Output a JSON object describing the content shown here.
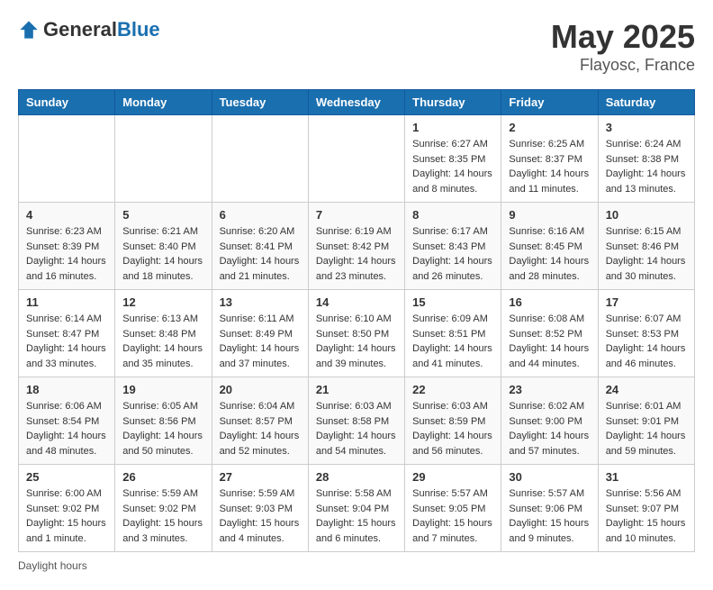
{
  "header": {
    "logo_general": "General",
    "logo_blue": "Blue",
    "month": "May 2025",
    "location": "Flayosc, France"
  },
  "weekdays": [
    "Sunday",
    "Monday",
    "Tuesday",
    "Wednesday",
    "Thursday",
    "Friday",
    "Saturday"
  ],
  "weeks": [
    [
      {
        "day": "",
        "info": ""
      },
      {
        "day": "",
        "info": ""
      },
      {
        "day": "",
        "info": ""
      },
      {
        "day": "",
        "info": ""
      },
      {
        "day": "1",
        "info": "Sunrise: 6:27 AM\nSunset: 8:35 PM\nDaylight: 14 hours and 8 minutes."
      },
      {
        "day": "2",
        "info": "Sunrise: 6:25 AM\nSunset: 8:37 PM\nDaylight: 14 hours and 11 minutes."
      },
      {
        "day": "3",
        "info": "Sunrise: 6:24 AM\nSunset: 8:38 PM\nDaylight: 14 hours and 13 minutes."
      }
    ],
    [
      {
        "day": "4",
        "info": "Sunrise: 6:23 AM\nSunset: 8:39 PM\nDaylight: 14 hours and 16 minutes."
      },
      {
        "day": "5",
        "info": "Sunrise: 6:21 AM\nSunset: 8:40 PM\nDaylight: 14 hours and 18 minutes."
      },
      {
        "day": "6",
        "info": "Sunrise: 6:20 AM\nSunset: 8:41 PM\nDaylight: 14 hours and 21 minutes."
      },
      {
        "day": "7",
        "info": "Sunrise: 6:19 AM\nSunset: 8:42 PM\nDaylight: 14 hours and 23 minutes."
      },
      {
        "day": "8",
        "info": "Sunrise: 6:17 AM\nSunset: 8:43 PM\nDaylight: 14 hours and 26 minutes."
      },
      {
        "day": "9",
        "info": "Sunrise: 6:16 AM\nSunset: 8:45 PM\nDaylight: 14 hours and 28 minutes."
      },
      {
        "day": "10",
        "info": "Sunrise: 6:15 AM\nSunset: 8:46 PM\nDaylight: 14 hours and 30 minutes."
      }
    ],
    [
      {
        "day": "11",
        "info": "Sunrise: 6:14 AM\nSunset: 8:47 PM\nDaylight: 14 hours and 33 minutes."
      },
      {
        "day": "12",
        "info": "Sunrise: 6:13 AM\nSunset: 8:48 PM\nDaylight: 14 hours and 35 minutes."
      },
      {
        "day": "13",
        "info": "Sunrise: 6:11 AM\nSunset: 8:49 PM\nDaylight: 14 hours and 37 minutes."
      },
      {
        "day": "14",
        "info": "Sunrise: 6:10 AM\nSunset: 8:50 PM\nDaylight: 14 hours and 39 minutes."
      },
      {
        "day": "15",
        "info": "Sunrise: 6:09 AM\nSunset: 8:51 PM\nDaylight: 14 hours and 41 minutes."
      },
      {
        "day": "16",
        "info": "Sunrise: 6:08 AM\nSunset: 8:52 PM\nDaylight: 14 hours and 44 minutes."
      },
      {
        "day": "17",
        "info": "Sunrise: 6:07 AM\nSunset: 8:53 PM\nDaylight: 14 hours and 46 minutes."
      }
    ],
    [
      {
        "day": "18",
        "info": "Sunrise: 6:06 AM\nSunset: 8:54 PM\nDaylight: 14 hours and 48 minutes."
      },
      {
        "day": "19",
        "info": "Sunrise: 6:05 AM\nSunset: 8:56 PM\nDaylight: 14 hours and 50 minutes."
      },
      {
        "day": "20",
        "info": "Sunrise: 6:04 AM\nSunset: 8:57 PM\nDaylight: 14 hours and 52 minutes."
      },
      {
        "day": "21",
        "info": "Sunrise: 6:03 AM\nSunset: 8:58 PM\nDaylight: 14 hours and 54 minutes."
      },
      {
        "day": "22",
        "info": "Sunrise: 6:03 AM\nSunset: 8:59 PM\nDaylight: 14 hours and 56 minutes."
      },
      {
        "day": "23",
        "info": "Sunrise: 6:02 AM\nSunset: 9:00 PM\nDaylight: 14 hours and 57 minutes."
      },
      {
        "day": "24",
        "info": "Sunrise: 6:01 AM\nSunset: 9:01 PM\nDaylight: 14 hours and 59 minutes."
      }
    ],
    [
      {
        "day": "25",
        "info": "Sunrise: 6:00 AM\nSunset: 9:02 PM\nDaylight: 15 hours and 1 minute."
      },
      {
        "day": "26",
        "info": "Sunrise: 5:59 AM\nSunset: 9:02 PM\nDaylight: 15 hours and 3 minutes."
      },
      {
        "day": "27",
        "info": "Sunrise: 5:59 AM\nSunset: 9:03 PM\nDaylight: 15 hours and 4 minutes."
      },
      {
        "day": "28",
        "info": "Sunrise: 5:58 AM\nSunset: 9:04 PM\nDaylight: 15 hours and 6 minutes."
      },
      {
        "day": "29",
        "info": "Sunrise: 5:57 AM\nSunset: 9:05 PM\nDaylight: 15 hours and 7 minutes."
      },
      {
        "day": "30",
        "info": "Sunrise: 5:57 AM\nSunset: 9:06 PM\nDaylight: 15 hours and 9 minutes."
      },
      {
        "day": "31",
        "info": "Sunrise: 5:56 AM\nSunset: 9:07 PM\nDaylight: 15 hours and 10 minutes."
      }
    ]
  ],
  "footer": {
    "note": "Daylight hours"
  }
}
